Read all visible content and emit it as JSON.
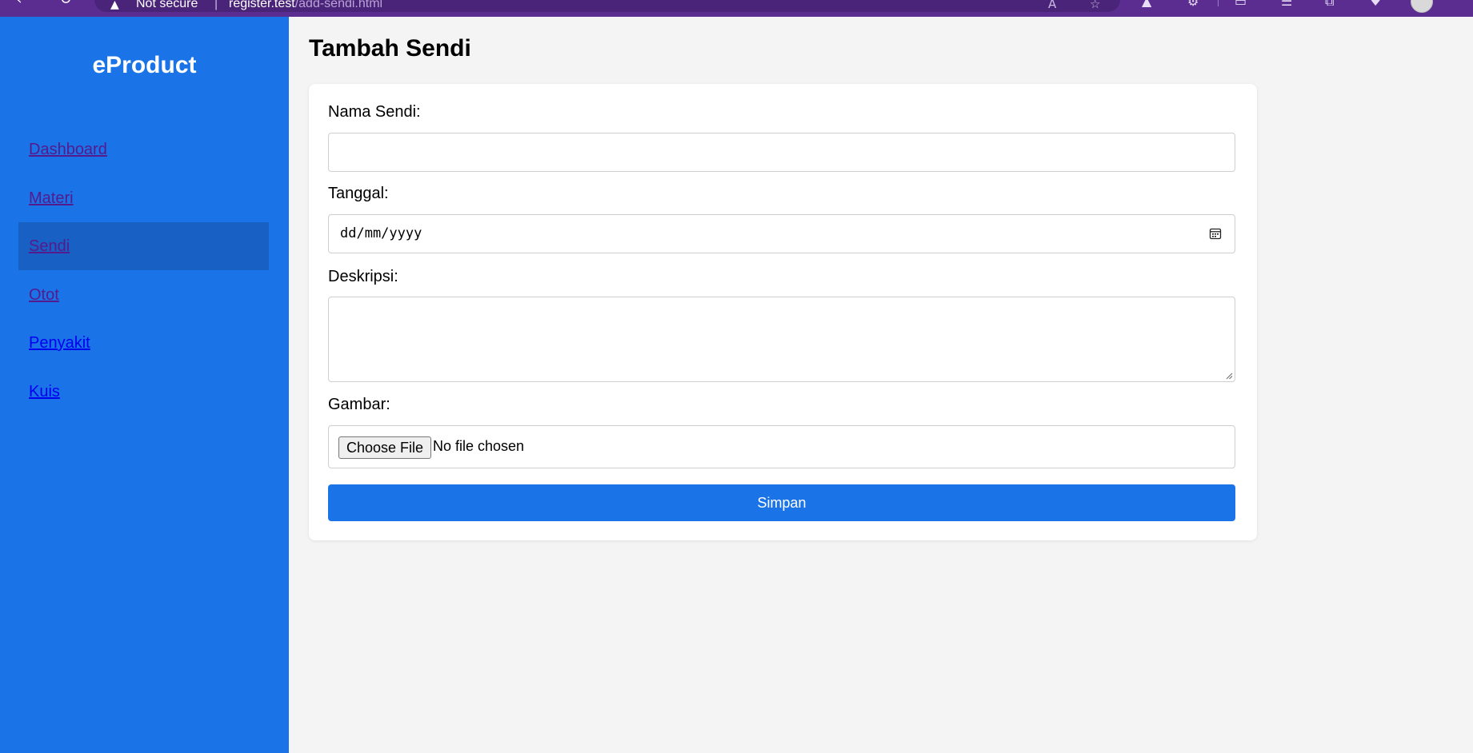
{
  "browser": {
    "security_text": "Not secure",
    "url_host": "register.test",
    "url_path": "/add-sendi.html"
  },
  "sidebar": {
    "brand": "eProduct",
    "items": [
      {
        "label": "Dashboard",
        "state": "visited"
      },
      {
        "label": "Materi",
        "state": "visited"
      },
      {
        "label": "Sendi",
        "state": "active"
      },
      {
        "label": "Otot",
        "state": "visited"
      },
      {
        "label": "Penyakit",
        "state": "unvisited"
      },
      {
        "label": "Kuis",
        "state": "unvisited"
      }
    ]
  },
  "main": {
    "title": "Tambah Sendi",
    "form": {
      "name_label": "Nama Sendi:",
      "name_value": "",
      "date_label": "Tanggal:",
      "date_placeholder": "dd/mm/yyyy",
      "description_label": "Deskripsi:",
      "description_value": "",
      "image_label": "Gambar:",
      "file_button_label": "Choose File",
      "file_status": "No file chosen",
      "submit_label": "Simpan"
    }
  },
  "colors": {
    "sidebar_bg": "#1b73e8",
    "active_item_bg": "#1860c4",
    "primary_button": "#1b73e8",
    "browser_chrome": "#5b2d91"
  }
}
